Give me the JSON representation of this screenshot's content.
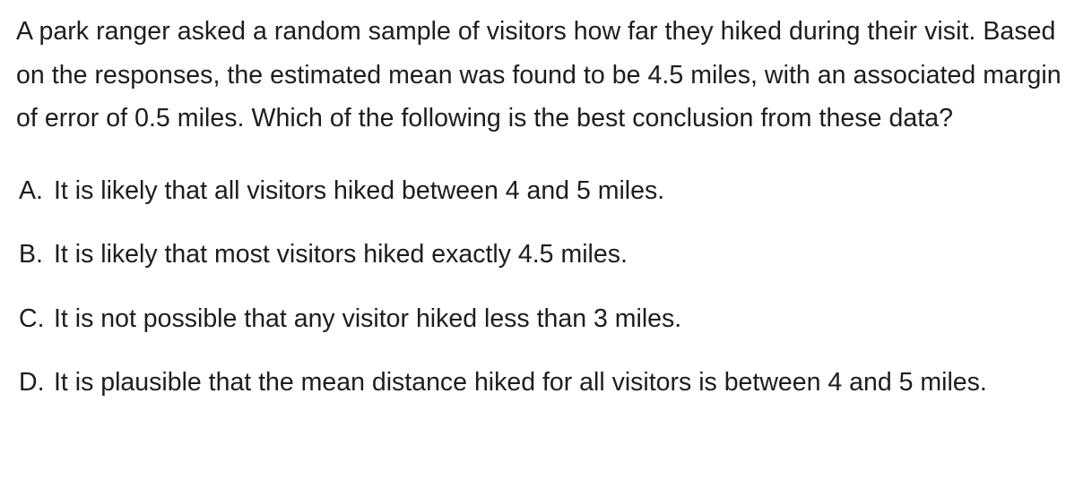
{
  "question": {
    "text": "A park ranger asked a random sample of visitors how far they hiked during their visit. Based on the responses, the estimated mean was found to be 4.5 miles, with an associated margin of error of 0.5 miles. Which of the following is the best conclusion from these data?"
  },
  "options": [
    {
      "letter": "A.",
      "text": "It is likely that all visitors hiked between 4 and 5 miles."
    },
    {
      "letter": "B.",
      "text": "It is likely that most visitors hiked exactly 4.5 miles."
    },
    {
      "letter": "C.",
      "text": "It is not possible that any visitor hiked less than 3 miles."
    },
    {
      "letter": "D.",
      "text": "It is plausible that the mean distance hiked for all visitors is between 4 and 5 miles."
    }
  ]
}
